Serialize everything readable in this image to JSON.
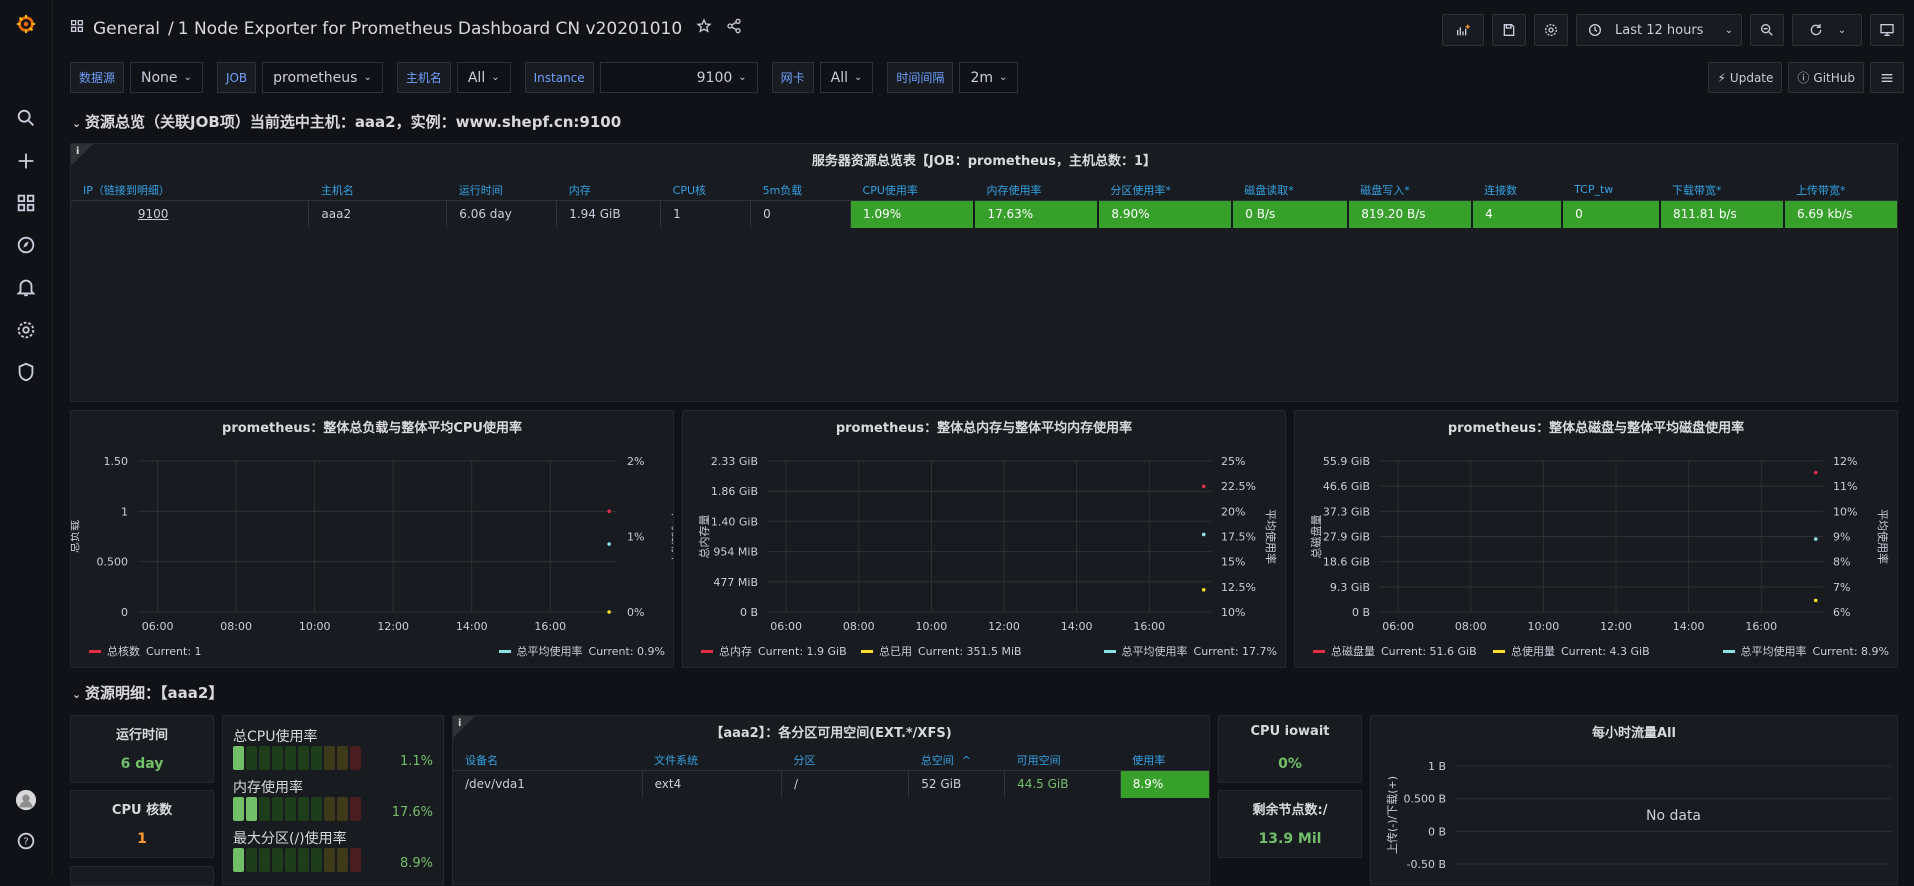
{
  "topbar": {
    "breadcrumb_folder": "General",
    "breadcrumb_sep": "/",
    "dashboard_title": "1 Node Exporter for Prometheus Dashboard CN v20201010",
    "time_range": "Last 12 hours"
  },
  "variables": [
    {
      "label": "数据源",
      "value": "None"
    },
    {
      "label": "JOB",
      "value": "prometheus"
    },
    {
      "label": "主机名",
      "value": "All"
    },
    {
      "label": "Instance",
      "value": "9100"
    },
    {
      "label": "网卡",
      "value": "All"
    },
    {
      "label": "时间间隔",
      "value": "2m"
    }
  ],
  "links": {
    "update": "Update",
    "github": "GitHub"
  },
  "row1_title": "资源总览（关联JOB项）当前选中主机：aaa2，实例：www.shepf.cn:9100",
  "overview": {
    "title": "服务器资源总览表【JOB：prometheus，主机总数：1】",
    "headers": [
      "IP（链接到明细）",
      "主机名",
      "运行时间",
      "内存",
      "CPU核",
      "5m负载",
      "CPU使用率",
      "内存使用率",
      "分区使用率*",
      "磁盘读取*",
      "磁盘写入*",
      "连接数",
      "TCP_tw",
      "下载带宽*",
      "上传带宽*"
    ],
    "row": [
      "9100",
      "aaa2",
      "6.06 day",
      "1.94 GiB",
      "1",
      "0",
      "1.09%",
      "17.63%",
      "8.90%",
      "0 B/s",
      "819.20 B/s",
      "4",
      "0",
      "811.81 b/s",
      "6.69 kb/s"
    ]
  },
  "charts": {
    "cpu": {
      "title": "prometheus：整体总负载与整体平均CPU使用率",
      "ylabel_left": "总负载",
      "ylabel_right": "平均使用率",
      "legend": [
        {
          "name": "总核数",
          "current": "Current: 1",
          "color": "#e02f44"
        },
        {
          "name": "总平均使用率",
          "current": "Current: 0.9%",
          "color": "#8ae1e6"
        }
      ]
    },
    "mem": {
      "title": "prometheus：整体总内存与整体平均内存使用率",
      "ylabel_left": "总内存量",
      "ylabel_right": "平均使用率",
      "legend": [
        {
          "name": "总内存",
          "current": "Current: 1.9 GiB",
          "color": "#e02f44"
        },
        {
          "name": "总已用",
          "current": "Current: 351.5 MiB",
          "color": "#fade2a"
        },
        {
          "name": "总平均使用率",
          "current": "Current: 17.7%",
          "color": "#8ae1e6"
        }
      ]
    },
    "disk": {
      "title": "prometheus：整体总磁盘与整体平均磁盘使用率",
      "ylabel_left": "总磁盘量",
      "ylabel_right": "平均使用率",
      "legend": [
        {
          "name": "总磁盘量",
          "current": "Current: 51.6 GiB",
          "color": "#e02f44"
        },
        {
          "name": "总使用量",
          "current": "Current: 4.3 GiB",
          "color": "#fade2a"
        },
        {
          "name": "总平均使用率",
          "current": "Current: 8.9%",
          "color": "#8ae1e6"
        }
      ]
    }
  },
  "chart_data": [
    {
      "type": "line",
      "title": "prometheus：整体总负载与整体平均CPU使用率",
      "ylabel": "总负载",
      "y2label": "平均使用率",
      "x_ticks": [
        "06:00",
        "08:00",
        "10:00",
        "12:00",
        "14:00",
        "16:00"
      ],
      "y_ticks": [
        "0",
        "0.500",
        "1",
        "1.50"
      ],
      "y2_ticks": [
        "0%",
        "1%",
        "2%"
      ],
      "ylim": [
        0,
        1.5
      ],
      "y2lim": [
        0,
        2
      ],
      "series": [
        {
          "name": "总核数",
          "axis": "left",
          "color": "#e02f44",
          "points": [
            [
              17.5,
              1
            ]
          ]
        },
        {
          "name": "总平均使用率",
          "axis": "right",
          "color": "#8ae1e6",
          "points": [
            [
              17.5,
              0.9
            ]
          ]
        },
        {
          "axis": "right",
          "color": "#fade2a",
          "points": [
            [
              17.5,
              0
            ]
          ]
        }
      ]
    },
    {
      "type": "line",
      "title": "prometheus：整体总内存与整体平均内存使用率",
      "ylabel": "总内存量",
      "y2label": "平均使用率",
      "x_ticks": [
        "06:00",
        "08:00",
        "10:00",
        "12:00",
        "14:00",
        "16:00"
      ],
      "y_ticks": [
        "0 B",
        "477 MiB",
        "954 MiB",
        "1.40 GiB",
        "1.86 GiB",
        "2.33 GiB"
      ],
      "y2_ticks": [
        "10%",
        "12.5%",
        "15%",
        "17.5%",
        "20%",
        "22.5%",
        "25%"
      ],
      "ylim": [
        0,
        2.33
      ],
      "y2lim": [
        10,
        25
      ],
      "series": [
        {
          "name": "总内存",
          "axis": "left",
          "color": "#e02f44",
          "points": [
            [
              17.5,
              1.94
            ]
          ]
        },
        {
          "name": "总平均使用率",
          "axis": "right",
          "color": "#8ae1e6",
          "points": [
            [
              17.5,
              17.7
            ]
          ]
        },
        {
          "name": "总已用",
          "axis": "left",
          "color": "#fade2a",
          "points": [
            [
              17.5,
              0.343
            ]
          ]
        }
      ]
    },
    {
      "type": "line",
      "title": "prometheus：整体总磁盘与整体平均磁盘使用率",
      "ylabel": "总磁盘量",
      "y2label": "平均使用率",
      "x_ticks": [
        "06:00",
        "08:00",
        "10:00",
        "12:00",
        "14:00",
        "16:00"
      ],
      "y_ticks": [
        "0 B",
        "9.3 GiB",
        "18.6 GiB",
        "27.9 GiB",
        "37.3 GiB",
        "46.6 GiB",
        "55.9 GiB"
      ],
      "y2_ticks": [
        "6%",
        "7%",
        "8%",
        "9%",
        "10%",
        "11%",
        "12%"
      ],
      "ylim": [
        0,
        55.9
      ],
      "y2lim": [
        6,
        12
      ],
      "series": [
        {
          "name": "总磁盘量",
          "axis": "left",
          "color": "#e02f44",
          "points": [
            [
              17.5,
              51.6
            ]
          ]
        },
        {
          "name": "总平均使用率",
          "axis": "right",
          "color": "#8ae1e6",
          "points": [
            [
              17.5,
              8.9
            ]
          ]
        },
        {
          "name": "总使用量",
          "axis": "left",
          "color": "#fade2a",
          "points": [
            [
              17.5,
              4.3
            ]
          ]
        }
      ]
    },
    {
      "type": "line",
      "title": "每小时流量All",
      "ylabel": "上传(-)/下载(+)",
      "y_ticks": [
        "-0.50 B",
        "0 B",
        "0.500 B",
        "1 B"
      ],
      "ylim": [
        -0.5,
        1
      ],
      "series": [],
      "empty_text": "No data"
    }
  ],
  "row2_title": "资源明细：【aaa2】",
  "stats": {
    "uptime": {
      "title": "运行时间",
      "value": "6 day",
      "color": "#73bf69"
    },
    "cpu_cores": {
      "title": "CPU 核数",
      "value": "1",
      "color": "#ff9830"
    },
    "iowait": {
      "title": "CPU iowait",
      "value": "0%",
      "color": "#73bf69"
    },
    "inodes": {
      "title": "剩余节点数:/",
      "value": "13.9 Mil",
      "color": "#73bf69"
    }
  },
  "gauges": [
    {
      "label": "总CPU使用率",
      "value": "1.1%",
      "fraction": 0.011
    },
    {
      "label": "内存使用率",
      "value": "17.6%",
      "fraction": 0.176
    },
    {
      "label": "最大分区(/)使用率",
      "value": "8.9%",
      "fraction": 0.089
    }
  ],
  "partition": {
    "title": "【aaa2】：各分区可用空间(EXT.*/XFS)",
    "headers": [
      "设备名",
      "文件系统",
      "分区",
      "总空间",
      "可用空间",
      "使用率"
    ],
    "sort_indicator": "^",
    "row": [
      "/dev/vda1",
      "ext4",
      "/",
      "52 GiB",
      "44.5 GiB",
      "8.9%"
    ]
  },
  "hourly": {
    "title": "每小时流量All",
    "nodata": "No data",
    "ylabel": "上传(-)/下载(+)",
    "y_ticks": [
      "1 B",
      "0.500 B",
      "0 B",
      "-0.50 B"
    ]
  }
}
